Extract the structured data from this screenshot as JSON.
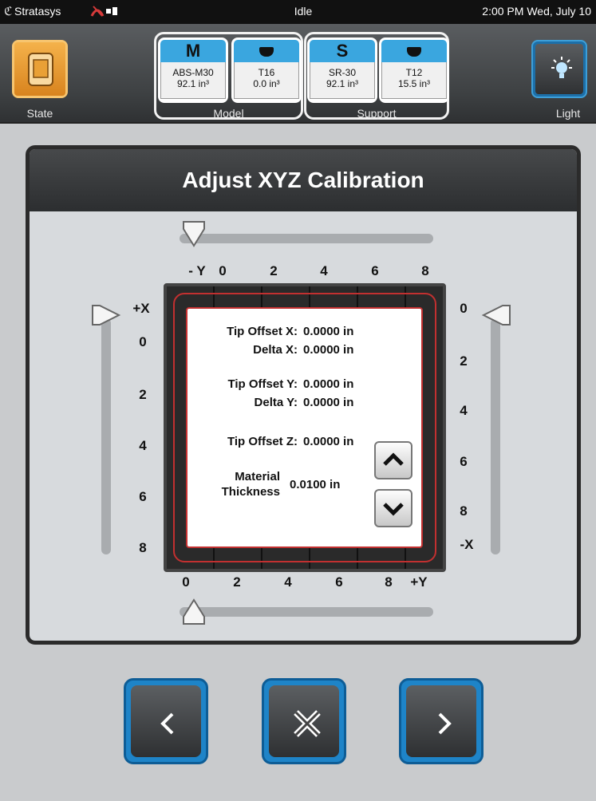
{
  "status_bar": {
    "brand": "Stratasys",
    "state": "Idle",
    "datetime": "2:00 PM Wed, July 10",
    "indicator_color": "#d63a3a"
  },
  "toolbar": {
    "state_label": "State",
    "light_label": "Light",
    "model_group_label": "Model",
    "support_group_label": "Support",
    "materials": [
      {
        "header": "M",
        "name": "ABS-M30",
        "amount": "92.1 in³"
      },
      {
        "header": "",
        "name": "T16",
        "amount": "0.0 in³"
      },
      {
        "header": "S",
        "name": "SR-30",
        "amount": "92.1 in³"
      },
      {
        "header": "",
        "name": "T12",
        "amount": "15.5 in³"
      }
    ]
  },
  "dialog": {
    "title": "Adjust XYZ Calibration",
    "top_axis": {
      "label": "- Y",
      "ticks": [
        "0",
        "2",
        "4",
        "6",
        "8"
      ]
    },
    "bottom_axis": {
      "ticks": [
        "0",
        "2",
        "4",
        "6",
        "8"
      ],
      "label": "+Y"
    },
    "left_axis": {
      "label": "+X",
      "ticks": [
        "0",
        "2",
        "4",
        "6",
        "8"
      ]
    },
    "right_axis": {
      "ticks": [
        "0",
        "2",
        "4",
        "6",
        "8"
      ],
      "label": "-X"
    },
    "slider_values": {
      "top": 0,
      "bottom": 0,
      "left": 0,
      "right": 0
    },
    "readouts": {
      "tip_offset_x_label": "Tip Offset X:",
      "tip_offset_x": "0.0000 in",
      "delta_x_label": "Delta X:",
      "delta_x": "0.0000 in",
      "tip_offset_y_label": "Tip Offset Y:",
      "tip_offset_y": "0.0000 in",
      "delta_y_label": "Delta Y:",
      "delta_y": "0.0000 in",
      "tip_offset_z_label": "Tip Offset Z:",
      "tip_offset_z": "0.0000 in",
      "material_label_1": "Material",
      "material_label_2": "Thickness",
      "material_thickness": "0.0100 in"
    }
  },
  "nav": {
    "back_icon": "chevron-left-icon",
    "cancel_icon": "close-icon",
    "next_icon": "chevron-right-icon"
  },
  "colors": {
    "accent_blue": "#1e84c8",
    "state_orange": "#e9a036",
    "grid_red": "#c23030"
  }
}
